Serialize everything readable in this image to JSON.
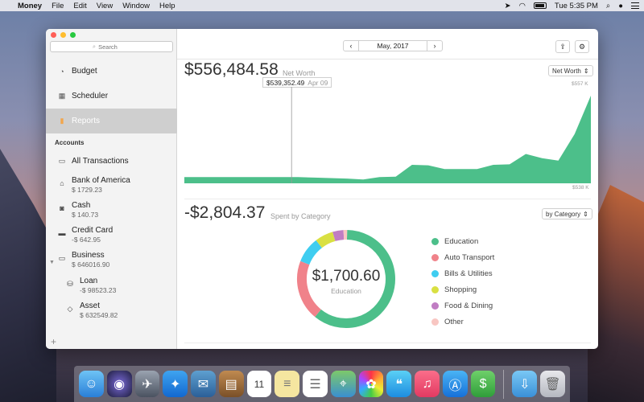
{
  "menubar": {
    "app_name": "Money",
    "menus": [
      "File",
      "Edit",
      "View",
      "Window",
      "Help"
    ],
    "clock": "Tue 5:35 PM"
  },
  "sidebar": {
    "search_placeholder": "Search",
    "nav": [
      {
        "label": "Budget",
        "icon": "budget-gauge-icon"
      },
      {
        "label": "Scheduler",
        "icon": "calendar-icon"
      },
      {
        "label": "Reports",
        "icon": "bar-chart-icon"
      }
    ],
    "accounts_title": "Accounts",
    "all_transactions": "All Transactions",
    "accounts": [
      {
        "name": "Bank of America",
        "balance": "$ 1729.23",
        "icon": "bank-icon"
      },
      {
        "name": "Cash",
        "balance": "$ 140.73",
        "icon": "cash-icon"
      },
      {
        "name": "Credit Card",
        "balance": "-$ 642.95",
        "icon": "credit-card-icon"
      },
      {
        "name": "Business",
        "balance": "$ 646016.90",
        "icon": "folder-icon"
      },
      {
        "name": "Loan",
        "balance": "-$ 98523.23",
        "icon": "loan-icon"
      },
      {
        "name": "Asset",
        "balance": "$ 632549.82",
        "icon": "diamond-icon"
      }
    ],
    "add_label": "+"
  },
  "toolbar": {
    "prev": "‹",
    "next": "›",
    "date": "May, 2017"
  },
  "net_worth": {
    "value": "$556,484.58",
    "label": "Net Worth",
    "dropdown": "Net Worth",
    "tooltip_value": "$539,352.49",
    "tooltip_date": "Apr 09",
    "axis_max": "$557 K",
    "axis_min": "$538 K"
  },
  "spending": {
    "value": "-$2,804.37",
    "label": "Spent by Category",
    "dropdown": "by Category",
    "donut_value": "$1,700.60",
    "donut_label": "Education"
  },
  "colors": {
    "green": "#4cbf8a",
    "auto": "#f0828a",
    "bills": "#3fcdf0",
    "shopping": "#d9e042",
    "food": "#c07dc3",
    "other": "#f8c6c2"
  },
  "chart_data": [
    {
      "type": "area",
      "ylim": [
        538,
        557
      ],
      "x": [
        0,
        1,
        2,
        3,
        4,
        5,
        6,
        7,
        8,
        9,
        10,
        11,
        12,
        13,
        14,
        15,
        16,
        17,
        18,
        19,
        20,
        21,
        22,
        23,
        24,
        25
      ],
      "values": [
        539.3,
        539.3,
        539.3,
        539.3,
        539.3,
        539.3,
        539.3,
        539.3,
        539.2,
        539.1,
        539.0,
        538.8,
        539.3,
        539.4,
        541.9,
        541.8,
        541.0,
        541.0,
        541.0,
        541.9,
        542.0,
        544.2,
        543.3,
        542.8,
        548.4,
        556.5
      ]
    },
    {
      "type": "pie",
      "categories": [
        "Education",
        "Auto Transport",
        "Bills & Utilities",
        "Shopping",
        "Food & Dining",
        "Other"
      ],
      "values": [
        1700.6,
        560,
        240,
        170,
        100,
        33.77
      ]
    }
  ]
}
